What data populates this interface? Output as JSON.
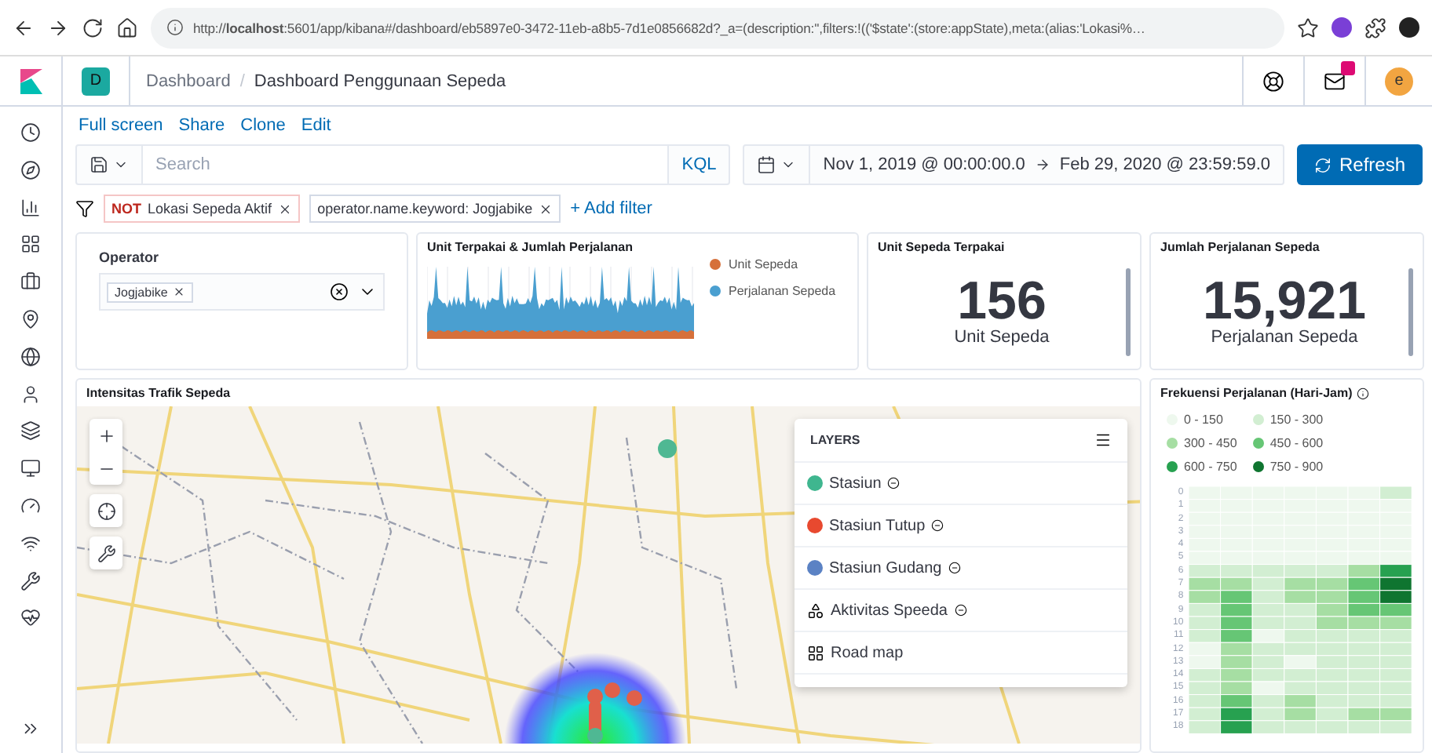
{
  "browser": {
    "url": "http://**localhost**:5601/app/kibana#/dashboard/eb5897e0-3472-11eb-a8b5-7d1e0856682d?_a=(description:'',filters:!(('$state':(store:appState),meta:(alias:'Lokasi%…"
  },
  "header": {
    "space": "D",
    "breadcrumbs": [
      "Dashboard",
      "Dashboard Penggunaan Sepeda"
    ],
    "separator": "/",
    "unread": true,
    "avatar": "e"
  },
  "top_nav": [
    "Full screen",
    "Share",
    "Clone",
    "Edit"
  ],
  "query": {
    "placeholder": "Search",
    "language": "KQL",
    "time_start": "Nov 1, 2019 @ 00:00:00.0",
    "time_end": "Feb 29, 2020 @ 23:59:59.0",
    "refresh": "Refresh"
  },
  "filters": [
    {
      "negated": true,
      "prefix": "NOT",
      "label": "Lokasi Sepeda Aktif"
    },
    {
      "negated": false,
      "label": "operator.name.keyword: Jogjabike"
    }
  ],
  "add_filter": "+ Add filter",
  "operator_panel": {
    "title": "Operator",
    "chips": [
      "Jogjabike"
    ]
  },
  "usage_panel": {
    "title": "Unit Terpakai & Jumlah Perjalanan",
    "legend": [
      {
        "label": "Unit Sepeda",
        "color": "#d6703a"
      },
      {
        "label": "Perjalanan Sepeda",
        "color": "#4a9fd0"
      }
    ]
  },
  "metrics": [
    {
      "title": "Unit Sepeda Terpakai",
      "value": "156",
      "label": "Unit Sepeda"
    },
    {
      "title": "Jumlah Perjalanan Sepeda",
      "value": "15,921",
      "label": "Perjalanan Sepeda"
    }
  ],
  "map_panel": {
    "title": "Intensitas Trafik Sepeda",
    "layers_title": "LAYERS",
    "layers": [
      {
        "kind": "dot",
        "label": "Stasiun",
        "color": "#3fb68f"
      },
      {
        "kind": "dot",
        "label": "Stasiun Tutup",
        "color": "#e8492f"
      },
      {
        "kind": "dot",
        "label": "Stasiun Gudang",
        "color": "#5b82c4"
      },
      {
        "kind": "heat",
        "label": "Aktivitas Speeda"
      },
      {
        "kind": "tiles",
        "label": "Road map"
      }
    ]
  },
  "heatmap_panel": {
    "title": "Frekuensi Perjalanan (Hari-Jam)",
    "legend": [
      {
        "label": "0 - 150",
        "color": "#eef8ee"
      },
      {
        "label": "150 - 300",
        "color": "#d2eed2"
      },
      {
        "label": "300 - 450",
        "color": "#a6dea3"
      },
      {
        "label": "450 - 600",
        "color": "#66c675"
      },
      {
        "label": "600 - 750",
        "color": "#27a150"
      },
      {
        "label": "750 - 900",
        "color": "#0f7530"
      }
    ],
    "hours": [
      "0",
      "1",
      "2",
      "3",
      "4",
      "5",
      "6",
      "7",
      "8",
      "9",
      "10",
      "11",
      "12",
      "13",
      "14",
      "15",
      "16",
      "17",
      "18"
    ]
  }
}
